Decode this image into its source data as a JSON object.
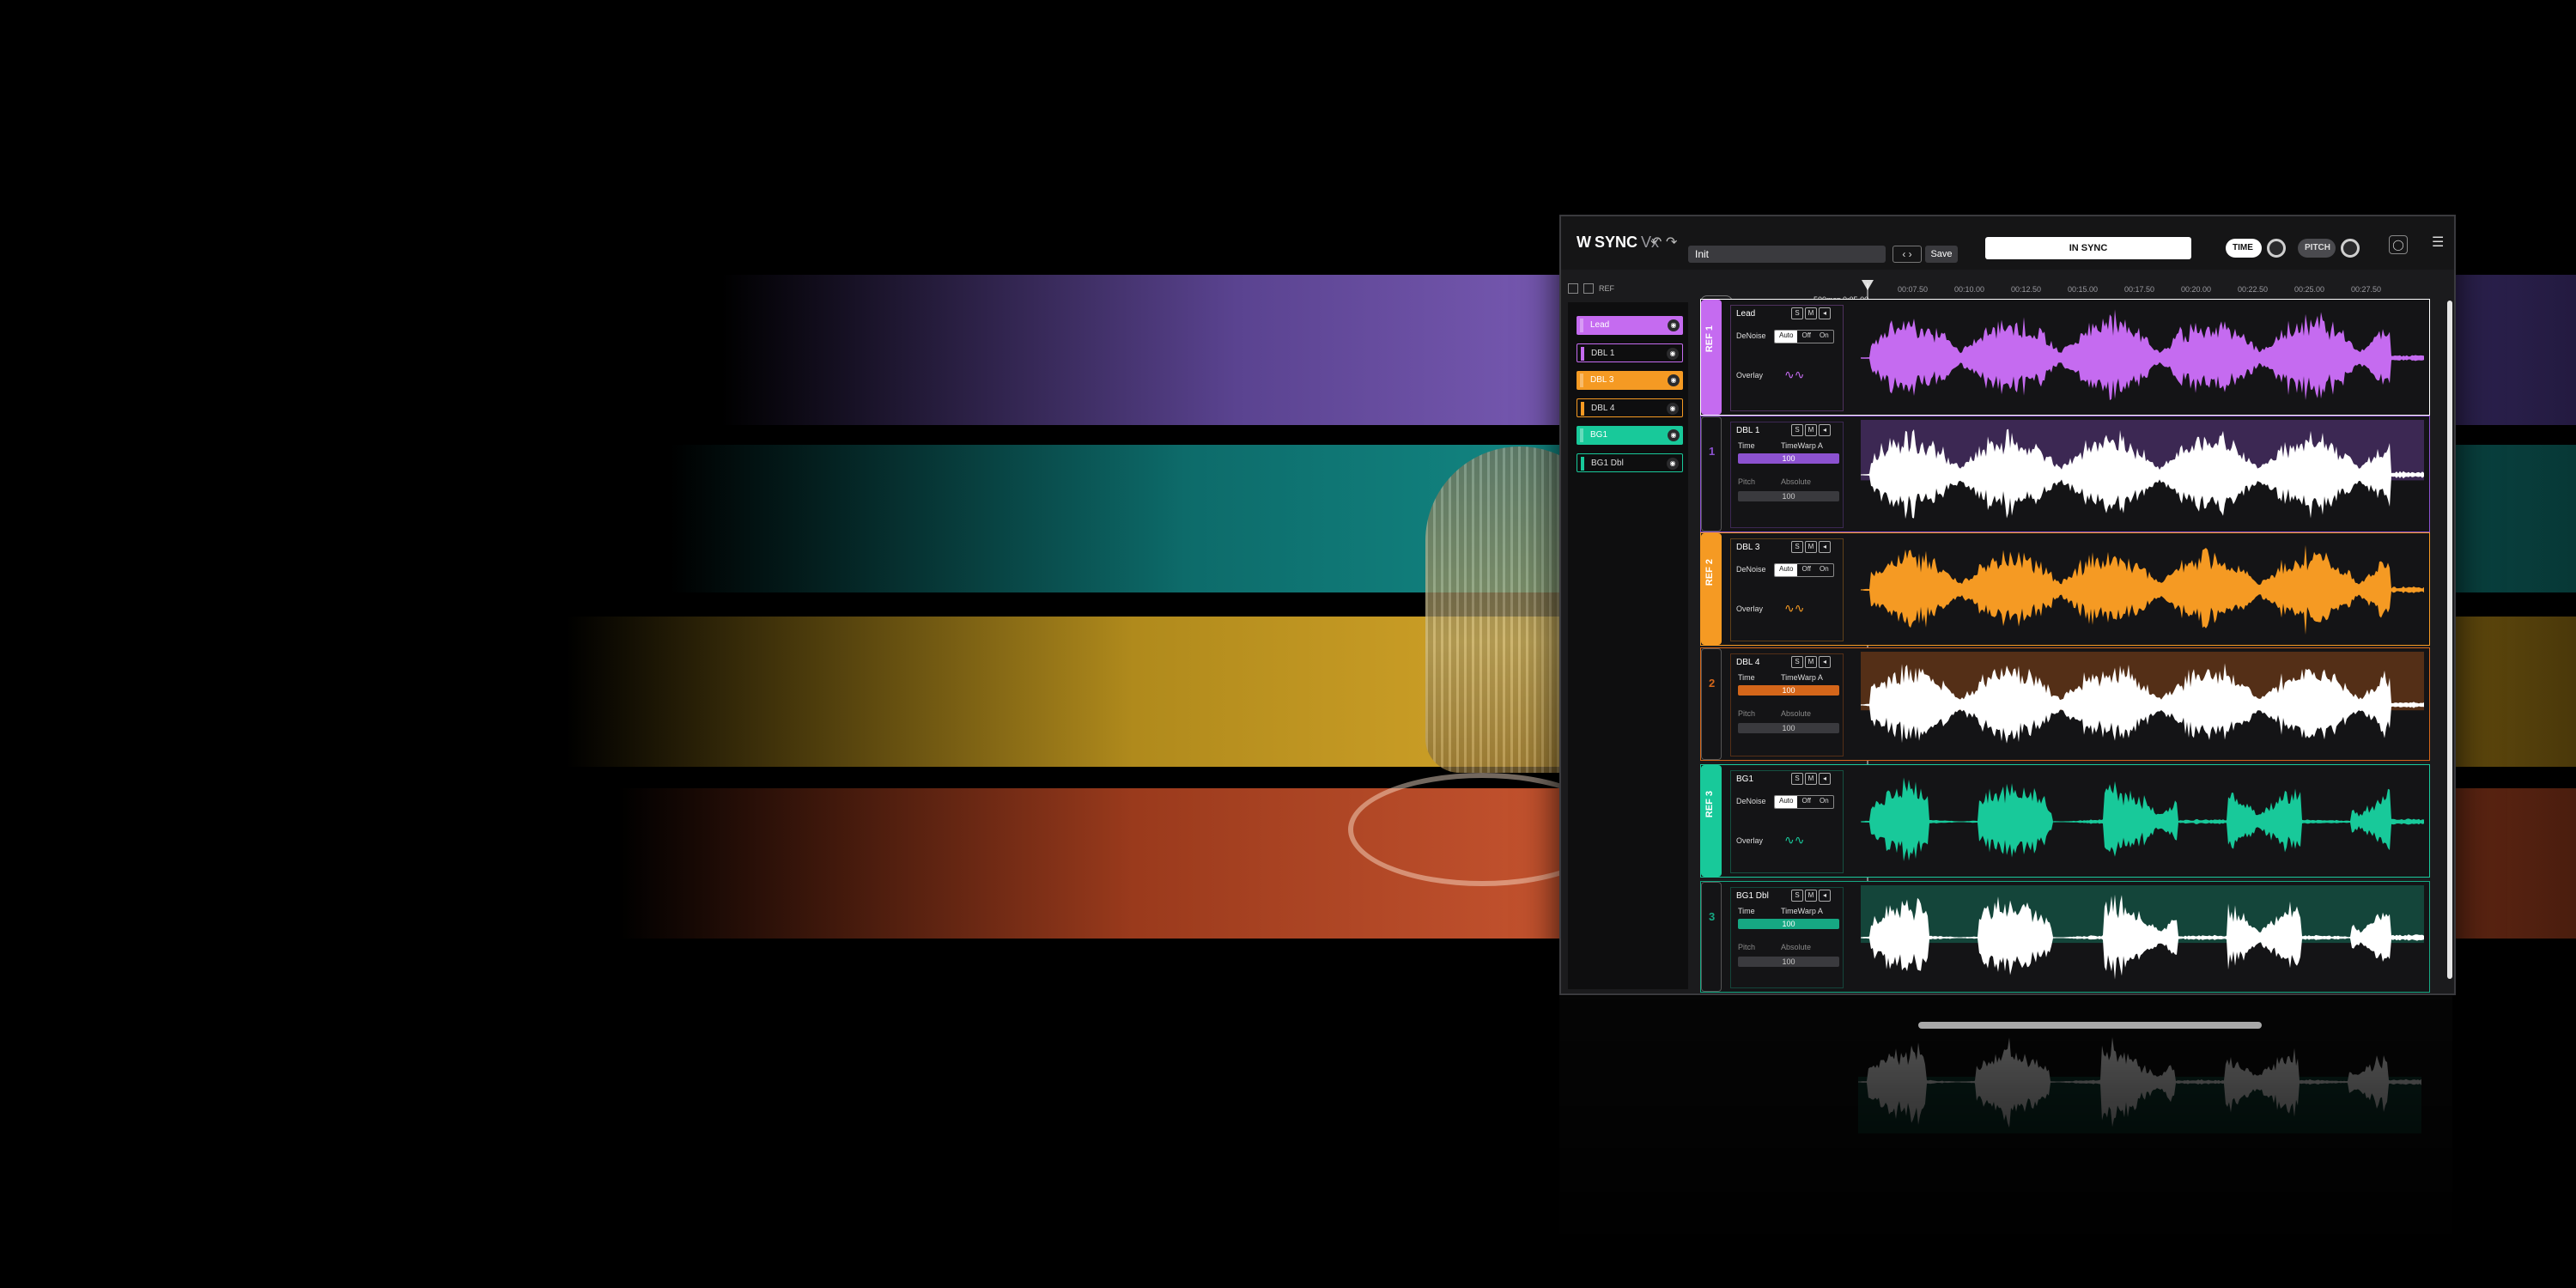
{
  "app": {
    "logo_main": "SYNC",
    "logo_suffix": "Vx",
    "logo_mark": "W"
  },
  "toolbar": {
    "undo_icon": "undo-icon",
    "redo_icon": "redo-icon",
    "preset_name": "Init",
    "save_label": "Save",
    "sync_status": "IN SYNC",
    "time_label": "TIME",
    "pitch_label": "PITCH"
  },
  "sidebar": {
    "ref_label": "REF",
    "items": [
      {
        "label": "Lead",
        "color": "#c56bf0",
        "filled": true
      },
      {
        "label": "DBL 1",
        "color": "#c56bf0",
        "filled": false
      },
      {
        "label": "DBL 3",
        "color": "#f59a23",
        "filled": true
      },
      {
        "label": "DBL 4",
        "color": "#f59a23",
        "filled": false
      },
      {
        "label": "BG1",
        "color": "#18c99a",
        "filled": true
      },
      {
        "label": "BG1 Dbl",
        "color": "#18c99a",
        "filled": false
      }
    ]
  },
  "timeline": {
    "all_label": "ALL",
    "zoom_label": "500ms",
    "start_time": "0:05.00",
    "ticks": [
      "00:07.50",
      "00:10.00",
      "00:12.50",
      "00:15.00",
      "00:17.50",
      "00:20.00",
      "00:22.50",
      "00:25.00",
      "00:27.50"
    ]
  },
  "tracks": [
    {
      "kind": "ref",
      "tab_label": "REF 1",
      "name": "Lead",
      "color": "#c56bf0",
      "denoise_label": "DeNoise",
      "denoise_options": [
        "Auto",
        "Off",
        "On"
      ],
      "denoise_selected": "Auto",
      "overlay_label": "Overlay",
      "s": "S",
      "m": "M"
    },
    {
      "kind": "dub",
      "tab_label": "1",
      "name": "DBL 1",
      "color": "#8c52d0",
      "time_label": "Time",
      "time_mode": "TimeWarp A",
      "time_value": "100",
      "pitch_label": "Pitch",
      "pitch_mode": "Absolute",
      "pitch_value": "100",
      "s": "S",
      "m": "M"
    },
    {
      "kind": "ref",
      "tab_label": "REF 2",
      "name": "DBL 3",
      "color": "#f59a23",
      "denoise_label": "DeNoise",
      "denoise_options": [
        "Auto",
        "Off",
        "On"
      ],
      "denoise_selected": "Auto",
      "overlay_label": "Overlay",
      "s": "S",
      "m": "M"
    },
    {
      "kind": "dub",
      "tab_label": "2",
      "name": "DBL 4",
      "color": "#d4661a",
      "time_label": "Time",
      "time_mode": "TimeWarp A",
      "time_value": "100",
      "pitch_label": "Pitch",
      "pitch_mode": "Absolute",
      "pitch_value": "100",
      "s": "S",
      "m": "M"
    },
    {
      "kind": "ref",
      "tab_label": "REF 3",
      "name": "BG1",
      "color": "#18c99a",
      "denoise_label": "DeNoise",
      "denoise_options": [
        "Auto",
        "Off",
        "On"
      ],
      "denoise_selected": "Auto",
      "overlay_label": "Overlay",
      "s": "S",
      "m": "M"
    },
    {
      "kind": "dub",
      "tab_label": "3",
      "name": "BG1 Dbl",
      "color": "#16a883",
      "time_label": "Time",
      "time_mode": "TimeWarp A",
      "time_value": "100",
      "pitch_label": "Pitch",
      "pitch_mode": "Absolute",
      "pitch_value": "100",
      "s": "S",
      "m": "M"
    }
  ]
}
